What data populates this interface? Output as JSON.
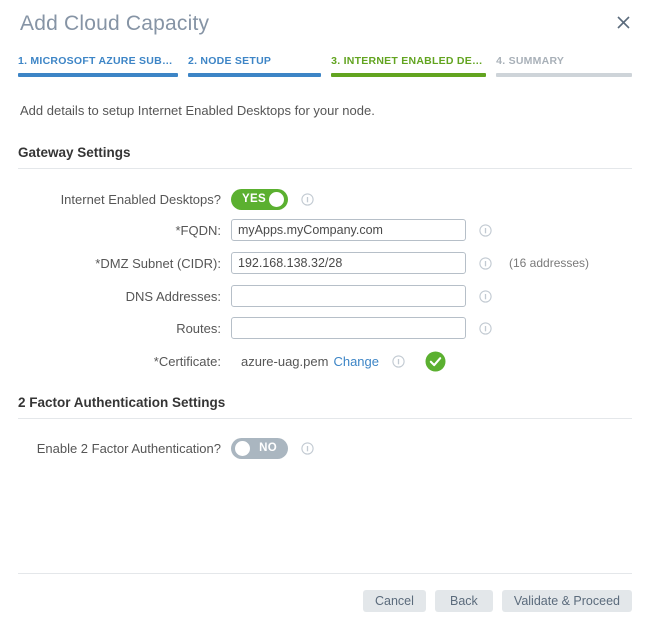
{
  "window": {
    "title": "Add Cloud Capacity",
    "close_icon": "close-icon"
  },
  "steps": [
    {
      "label": "1. MICROSOFT AZURE SUBSCR...",
      "state": "done"
    },
    {
      "label": "2. NODE SETUP",
      "state": "done"
    },
    {
      "label": "3. INTERNET ENABLED DESKT...",
      "state": "active"
    },
    {
      "label": "4. SUMMARY",
      "state": "todo"
    }
  ],
  "intro": "Add details to setup Internet Enabled Desktops for your node.",
  "sections": {
    "gateway": {
      "title": "Gateway Settings",
      "fields": {
        "internet_enabled": {
          "label": "Internet Enabled Desktops?",
          "toggle_value": "YES",
          "toggle_state": "on",
          "info_icon": "info-icon"
        },
        "fqdn": {
          "label": "FQDN:",
          "required": "*",
          "value": "myApps.myCompany.com",
          "placeholder": "",
          "info_icon": "info-icon"
        },
        "dmz_subnet": {
          "label": "DMZ Subnet (CIDR):",
          "required": "*",
          "value": "192.168.138.32/28",
          "placeholder": "",
          "info_icon": "info-icon",
          "hint": "(16 addresses)"
        },
        "dns_addresses": {
          "label": "DNS Addresses:",
          "required": "",
          "value": "",
          "placeholder": "",
          "info_icon": "info-icon"
        },
        "routes": {
          "label": "Routes:",
          "required": "",
          "value": "",
          "placeholder": "",
          "info_icon": "info-icon"
        },
        "certificate": {
          "label": "Certificate:",
          "required": "*",
          "value": "azure-uag.pem",
          "change_label": "Change",
          "info_icon": "info-icon",
          "status_icon": "check-circle-icon"
        }
      }
    },
    "two_factor": {
      "title": "2 Factor Authentication Settings",
      "fields": {
        "enable_2fa": {
          "label": "Enable 2 Factor Authentication?",
          "toggle_value": "NO",
          "toggle_state": "off",
          "info_icon": "info-icon"
        }
      }
    }
  },
  "footer": {
    "cancel_label": "Cancel",
    "back_label": "Back",
    "validate_label": "Validate & Proceed"
  },
  "colors": {
    "step_done": "#3d85c6",
    "step_active": "#62a420",
    "step_todo": "#ced4d9",
    "toggle_on": "#5bb030",
    "toggle_off": "#aab6c0",
    "link": "#3d85c6",
    "success": "#5bb030"
  }
}
